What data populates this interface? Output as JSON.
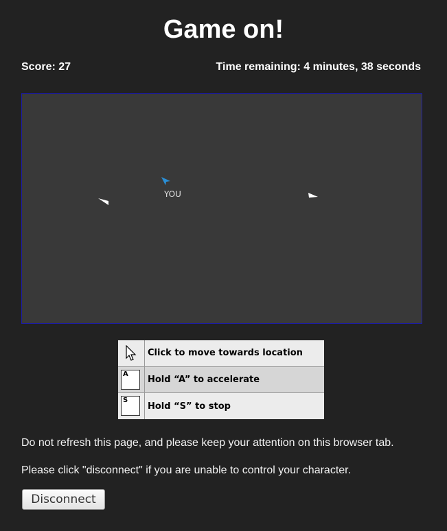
{
  "header": {
    "title": "Game on!",
    "score": "Score: 27",
    "time_remaining": "Time remaining: 4 minutes, 38 seconds"
  },
  "game": {
    "player_label": "YOU",
    "player_color": "#2a8fd6",
    "opponent_color": "#ffffff",
    "area_background": "#393939",
    "area_border": "#1c1ca8"
  },
  "controls": [
    {
      "icon": "mouse-cursor-icon",
      "key": "",
      "label": "Click to move towards location"
    },
    {
      "icon": "key-a-icon",
      "key": "A",
      "label": "Hold “A” to accelerate"
    },
    {
      "icon": "key-s-icon",
      "key": "S",
      "label": "Hold “S” to stop"
    }
  ],
  "notes": {
    "refresh": "Do not refresh this page, and please keep your attention on this browser tab.",
    "disconnect_hint": "Please click \"disconnect\" if you are unable to control your character."
  },
  "buttons": {
    "disconnect": "Disconnect"
  }
}
